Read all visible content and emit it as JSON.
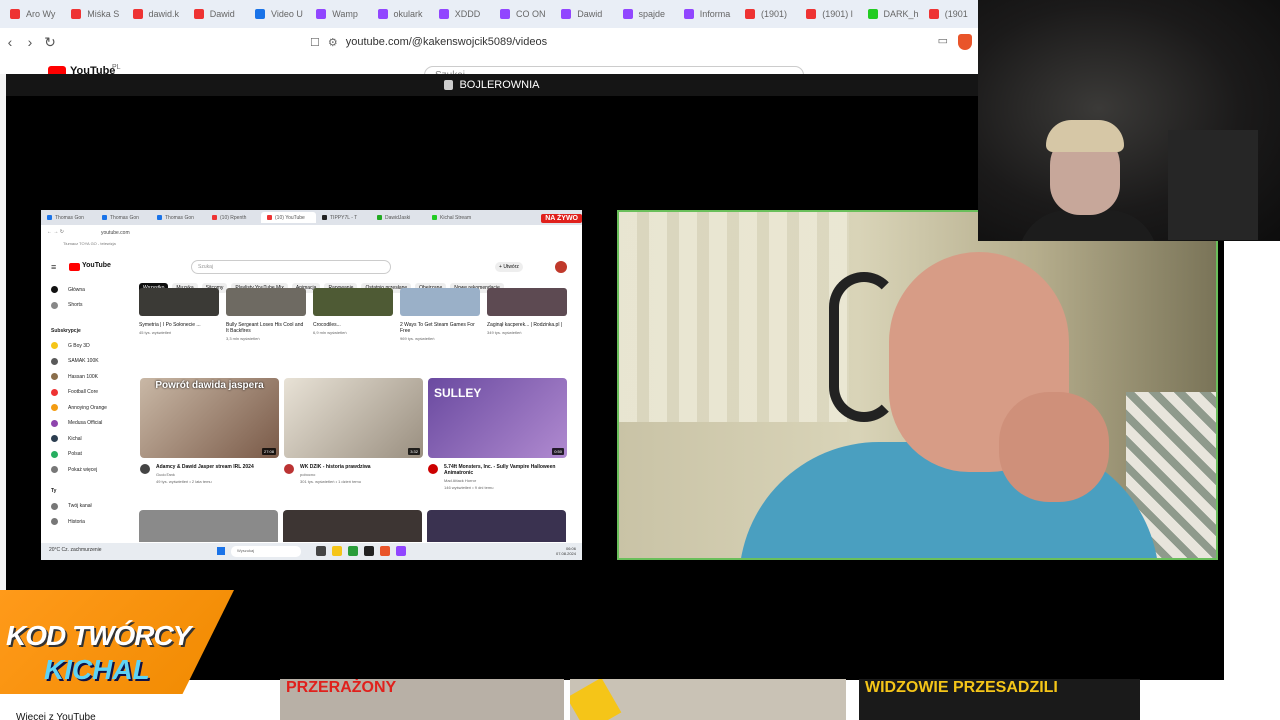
{
  "browser": {
    "tabs": [
      {
        "label": "Aro Wy",
        "color": "#e33"
      },
      {
        "label": "Miśka S",
        "color": "#e33"
      },
      {
        "label": "dawid.k",
        "color": "#e33"
      },
      {
        "label": "Dawid",
        "color": "#e33"
      },
      {
        "label": "Video U",
        "color": "#1a73e8"
      },
      {
        "label": "Wamp",
        "color": "#9146ff"
      },
      {
        "label": "okulark",
        "color": "#9146ff"
      },
      {
        "label": "XDDD",
        "color": "#9146ff"
      },
      {
        "label": "CO ON",
        "color": "#9146ff"
      },
      {
        "label": "Dawid",
        "color": "#9146ff"
      },
      {
        "label": "spajde",
        "color": "#9146ff"
      },
      {
        "label": "Informa",
        "color": "#9146ff"
      },
      {
        "label": "(1901)",
        "color": "#e33"
      },
      {
        "label": "(1901) l",
        "color": "#e33"
      },
      {
        "label": "DARK_h",
        "color": "#2c2"
      },
      {
        "label": "(1901",
        "color": "#e33"
      }
    ],
    "url": "youtube.com/@kakenswojcik5089/videos",
    "peek": {
      "logo": "YouTube",
      "region": "PL",
      "search_placeholder": "Szukaj"
    }
  },
  "stream": {
    "title": "BOJLEROWNIA",
    "live_badge": "NA ŻYWO"
  },
  "inner": {
    "tabs": [
      "Thomas Gon",
      "Thomas Gon",
      "Thomas Gon",
      "(10) Rpenth",
      "(10) YouTube",
      "TIPPY7L - T",
      "DawidJaski",
      "Kichal Stream"
    ],
    "url": "youtube.com",
    "bookmarks": "Tłumacz   TOYA GO - telewizja",
    "logo": "YouTube",
    "search_placeholder": "Szukaj",
    "create_label": "Utwórz",
    "sidebar": {
      "main": [
        "Główna",
        "Shorts"
      ],
      "subs_header": "Subskrypcje",
      "subs": [
        "G Boy 3D",
        "SAMAK 100K",
        "Hassan 100K",
        "Football Core",
        "Annoying Orange",
        "Medusa Official",
        "Kichal",
        "Polsat",
        "Pokaż więcej"
      ],
      "you_header": "Ty",
      "you": [
        "Twój kanał",
        "Historia"
      ]
    },
    "chips": [
      "Wszystko",
      "Muzyka",
      "Sitcomy",
      "Playlisty YouTube Mix",
      "Animacja",
      "Rapowanie",
      "Ostatnio przesłane",
      "Obejrzane",
      "Nowe rekomendacje"
    ],
    "top_row": [
      {
        "title": "Symetria | I Po Sołonecie ...",
        "stats": "45 tys. wyświetleń"
      },
      {
        "title": "Bully Sergeant Loses His Cool and It Backfires",
        "stats": "3,3 mln wyświetleń"
      },
      {
        "title": "Crocodiles...",
        "stats": "6,9 mln wyświetleń"
      },
      {
        "title": "2 Ways To Get Steam Games For Free",
        "stats": "969 tys. wyświetleń"
      },
      {
        "title": "Zaginął kacperek... | Rodzinka.pl |",
        "stats": "349 tys. wyświetleń"
      }
    ],
    "cards": [
      {
        "title": "Adamcy & Dawid Jasper stream IRL 2024",
        "channel": "GucioTank",
        "stats": "49 tys. wyświetleń • 2 lata temu",
        "duration": "27:08",
        "thumb_text": "Powrót dawida jaspera"
      },
      {
        "title": "WK DZIK - historia prawdziwa",
        "channel": "pobocno",
        "stats": "301 tys. wyświetleń • 1 dzień temu",
        "duration": "3:32",
        "thumb_text": ""
      },
      {
        "title": "5.74ft Monsters, Inc. - Sully Vampire Halloween Animatronic",
        "channel": "Mad Attack Horror",
        "stats": "146 wyświetleń • 9 dni temu",
        "duration": "0:50",
        "thumb_text": "SULLEY"
      }
    ],
    "taskbar": {
      "weather": "20°C  Cz. zachmurzenie",
      "search": "Wyszukaj",
      "time": "06:06",
      "date": "07.08.2024"
    }
  },
  "bottom": {
    "more": "Więcej z YouTube",
    "thumb_captions": [
      "PRZERAŻONY",
      "",
      "WIDZOWIE PRZESADZILI"
    ]
  },
  "overlay": {
    "code_line1": "KOD TWÓRCY",
    "code_line2": "KICHAL"
  }
}
